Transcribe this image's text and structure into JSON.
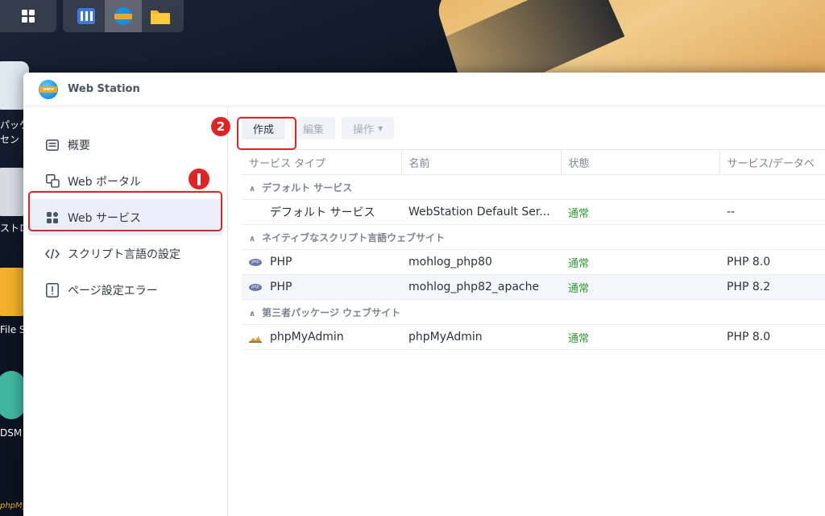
{
  "desktop": {
    "labels": [
      "パッケ",
      "セン",
      "ストロー",
      "File S",
      "DSM",
      "phpMy"
    ]
  },
  "window": {
    "title": "Web Station",
    "app_icon_text": "www"
  },
  "sidebar": {
    "items": [
      {
        "label": "概要",
        "icon": "overview-icon"
      },
      {
        "label": "Web ポータル",
        "icon": "web-portal-icon"
      },
      {
        "label": "Web サービス",
        "icon": "web-service-icon",
        "selected": true
      },
      {
        "label": "スクリプト言語の設定",
        "icon": "code-icon"
      },
      {
        "label": "ページ設定エラー",
        "icon": "error-page-icon"
      }
    ]
  },
  "toolbar": {
    "create_label": "作成",
    "edit_label": "編集",
    "action_label": "操作"
  },
  "table": {
    "headers": [
      "サービス タイプ",
      "名前",
      "状態",
      "サービス/データベ"
    ],
    "groups": [
      {
        "label": "デフォルト サービス",
        "rows": [
          {
            "type": "デフォルト サービス",
            "name": "WebStation Default Ser...",
            "status": "通常",
            "service": "--"
          }
        ]
      },
      {
        "label": "ネイティブなスクリプト言語ウェブサイト",
        "rows": [
          {
            "type": "PHP",
            "name": "mohlog_php80",
            "status": "通常",
            "service": "PHP 8.0"
          },
          {
            "type": "PHP",
            "name": "mohlog_php82_apache",
            "status": "通常",
            "service": "PHP 8.2"
          }
        ]
      },
      {
        "label": "第三者パッケージ ウェブサイト",
        "rows": [
          {
            "type": "phpMyAdmin",
            "name": "phpMyAdmin",
            "status": "通常",
            "service": "PHP 8.0"
          }
        ]
      }
    ]
  },
  "annotations": {
    "marker2": "2"
  },
  "colors": {
    "accent_red": "#e02424",
    "status_green": "#2a9d2e",
    "selection_bg": "#e8eefa"
  }
}
